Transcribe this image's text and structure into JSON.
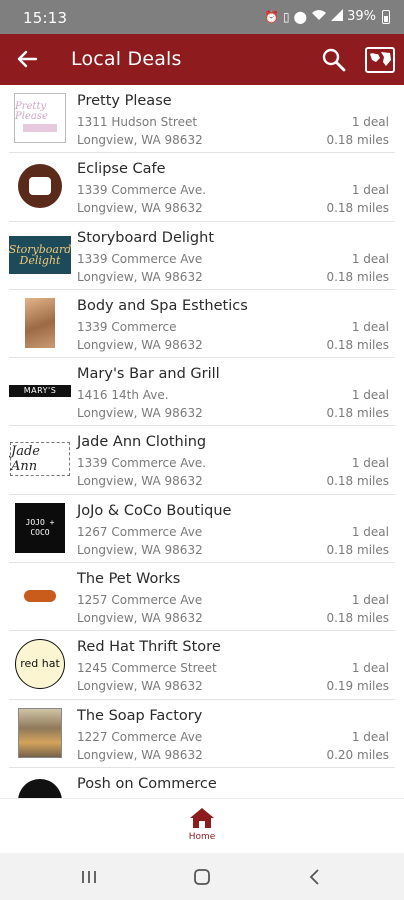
{
  "status_bar": {
    "time": "15:13",
    "battery": "39%",
    "icons": [
      "alarm-icon",
      "vibrate-icon",
      "location-icon",
      "wifi-icon",
      "signal-icon",
      "battery-icon"
    ]
  },
  "app_bar": {
    "title": "Local Deals",
    "color": "#8e1b1d",
    "icons": [
      "back-arrow-icon",
      "search-icon",
      "map-icon"
    ]
  },
  "businesses": [
    {
      "name": "Pretty Please",
      "address": "1311 Hudson Street",
      "city": "Longview, WA 98632",
      "deals": "1 deal",
      "distance": "0.18 miles",
      "logo_text": "Pretty Please"
    },
    {
      "name": "Eclipse Cafe",
      "address": "1339 Commerce Ave.",
      "city": "Longview, WA 98632",
      "deals": "1 deal",
      "distance": "0.18 miles",
      "logo_text": ""
    },
    {
      "name": "Storyboard Delight",
      "address": "1339 Commerce Ave",
      "city": "Longview, WA 98632",
      "deals": "1 deal",
      "distance": "0.18 miles",
      "logo_text": "Storyboard Delight"
    },
    {
      "name": "Body and Spa Esthetics",
      "address": "1339 Commerce",
      "city": "Longview, WA 98632",
      "deals": "1 deal",
      "distance": "0.18 miles",
      "logo_text": ""
    },
    {
      "name": "Mary's Bar and Grill",
      "address": "1416 14th Ave.",
      "city": "Longview, WA 98632",
      "deals": "1 deal",
      "distance": "0.18 miles",
      "logo_text": "MARY'S"
    },
    {
      "name": "Jade Ann Clothing",
      "address": "1339 Commerce Ave.",
      "city": "Longview, WA 98632",
      "deals": "1 deal",
      "distance": "0.18 miles",
      "logo_text": "Jade Ann"
    },
    {
      "name": "JoJo & CoCo Boutique",
      "address": "1267 Commerce Ave",
      "city": "Longview, WA 98632",
      "deals": "1 deal",
      "distance": "0.18 miles",
      "logo_text": "JOJO + COCO"
    },
    {
      "name": "The Pet Works",
      "address": "1257 Commerce Ave",
      "city": "Longview, WA 98632",
      "deals": "1 deal",
      "distance": "0.18 miles",
      "logo_text": ""
    },
    {
      "name": "Red Hat Thrift Store",
      "address": "1245 Commerce Street",
      "city": "Longview, WA 98632",
      "deals": "1 deal",
      "distance": "0.19 miles",
      "logo_text": "red hat"
    },
    {
      "name": "The Soap Factory",
      "address": "1227 Commerce Ave",
      "city": "Longview, WA 98632",
      "deals": "1 deal",
      "distance": "0.20 miles",
      "logo_text": ""
    },
    {
      "name": "Posh on Commerce",
      "address": "",
      "city": "",
      "deals": "",
      "distance": "",
      "logo_text": ""
    }
  ],
  "bottom_nav": {
    "home_label": "Home"
  }
}
